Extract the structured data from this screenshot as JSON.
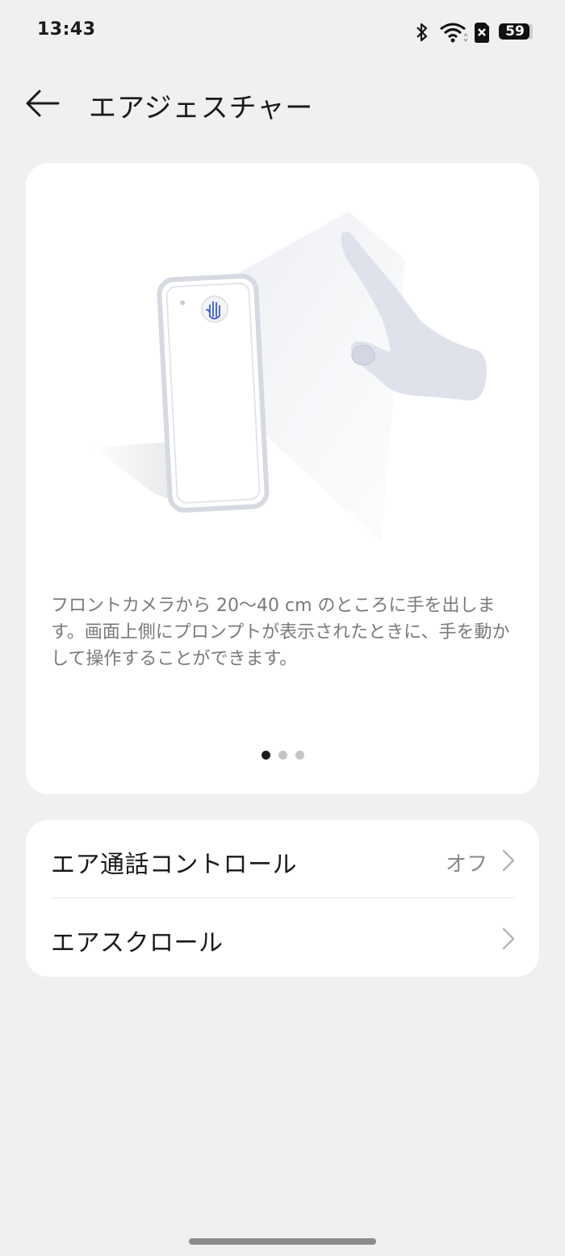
{
  "status_bar": {
    "time": "13:43",
    "battery": "59",
    "icons": [
      "bluetooth-icon",
      "wifi-icon",
      "sim-error-icon",
      "battery-icon"
    ]
  },
  "header": {
    "back_icon": "arrow-left-icon",
    "title": "エアジェスチャー"
  },
  "illustration_card": {
    "description": "フロントカメラから 20〜40 cm のところに手を出します。画面上側にプロンプトが表示されたときに、手を動かして操作することができます。",
    "pager": {
      "count": 3,
      "active": 0
    }
  },
  "settings": [
    {
      "label": "エア通話コントロール",
      "value": "オフ",
      "icon": "chevron-right-icon"
    },
    {
      "label": "エアスクロール",
      "value": "",
      "icon": "chevron-right-icon"
    }
  ],
  "colors": {
    "background": "#eff0f2",
    "card": "#ffffff",
    "secondary_text": "#7a7a7a",
    "illustration": "#dfe2ea",
    "accent": "#3b5bd6"
  }
}
